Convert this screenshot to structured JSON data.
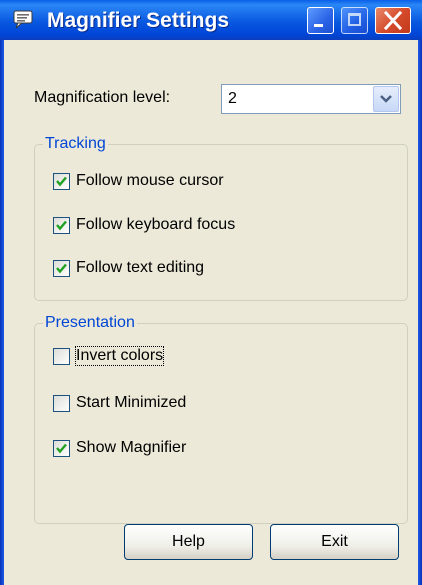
{
  "window": {
    "title": "Magnifier Settings",
    "colors": {
      "title_bar": "#0058E6",
      "client_bg": "#ECE9D8",
      "group_text": "#0046D5",
      "close_button": "#D4492A"
    }
  },
  "title_buttons": {
    "minimize": "minimize-icon",
    "maximize": "maximize-icon",
    "close": "close-icon"
  },
  "magnification": {
    "label": "Magnification level:",
    "value": "2"
  },
  "tracking": {
    "title": "Tracking",
    "items": [
      {
        "label": "Follow mouse cursor",
        "checked": true
      },
      {
        "label": "Follow keyboard focus",
        "checked": true
      },
      {
        "label": "Follow text editing",
        "checked": true
      }
    ]
  },
  "presentation": {
    "title": "Presentation",
    "items": [
      {
        "label": "Invert colors",
        "checked": false
      },
      {
        "label": "Start Minimized",
        "checked": false
      },
      {
        "label": "Show Magnifier",
        "checked": true
      }
    ]
  },
  "buttons": {
    "help": "Help",
    "exit": "Exit"
  }
}
